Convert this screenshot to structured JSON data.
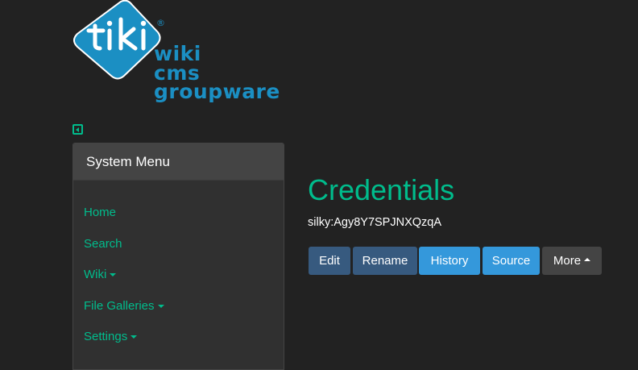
{
  "logo": {
    "brand": "tiki",
    "lines": [
      "wiki",
      "cms",
      "groupware"
    ],
    "registered": "®",
    "colors": {
      "diamond": "#1b8fc3",
      "text": "#1b8fc3"
    }
  },
  "sidebar": {
    "toggle_icon": "caret-left-square-icon",
    "title": "System Menu",
    "items": [
      {
        "label": "Home",
        "has_caret": false
      },
      {
        "label": "Search",
        "has_caret": false
      },
      {
        "label": "Wiki",
        "has_caret": true
      },
      {
        "label": "File Galleries",
        "has_caret": true
      },
      {
        "label": "Settings",
        "has_caret": true
      }
    ]
  },
  "main": {
    "title": "Credentials",
    "subtitle": "silky:Agy8Y7SPJNXQzqA",
    "actions": {
      "edit": "Edit",
      "rename": "Rename",
      "history": "History",
      "source": "Source",
      "more": "More"
    }
  },
  "colors": {
    "background": "#222222",
    "accent": "#00bc8c",
    "primary": "#375a7f",
    "info": "#3498db"
  }
}
